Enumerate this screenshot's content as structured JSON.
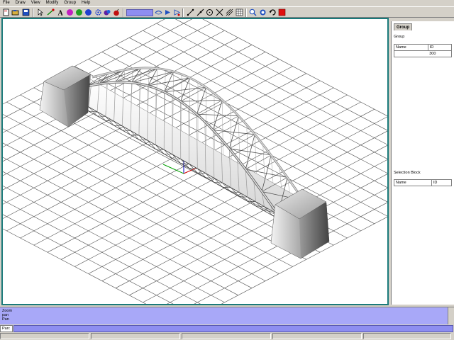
{
  "menu": [
    "File",
    "Draw",
    "View",
    "Modify",
    "Group",
    "Help"
  ],
  "toolbar": {
    "icons": [
      "new-icon",
      "open-icon",
      "save-icon",
      "select-arrow-icon",
      "node-icon",
      "text-icon",
      "color-icon",
      "sphere-icon",
      "circle-fill-icon",
      "gear-icon",
      "paint-icon",
      "bomb-icon",
      "zoom-field",
      "pan-icon",
      "arrow-icon",
      "snap-icon",
      "line-icon",
      "pencil-icon",
      "circle-icon",
      "cross-icon",
      "grid-icon",
      "zoom-in-icon",
      "hand-icon",
      "rotate-icon",
      "stop-icon"
    ]
  },
  "panel": {
    "tab": "Group",
    "group_label": "Group",
    "group_cols": [
      "Name",
      "ID"
    ],
    "group_rows": [
      {
        "name": "",
        "id": "300"
      }
    ],
    "selection_label": "Selection Block",
    "selection_cols": [
      "Name",
      "ID"
    ]
  },
  "command": {
    "history": [
      "Zoom",
      "pan",
      "Pan"
    ],
    "prompt": "Pan:"
  },
  "colors": {
    "canvas_border": "#1a7a7a",
    "command_bg": "#a8a8f8",
    "input_bg": "#8e8ef0"
  }
}
